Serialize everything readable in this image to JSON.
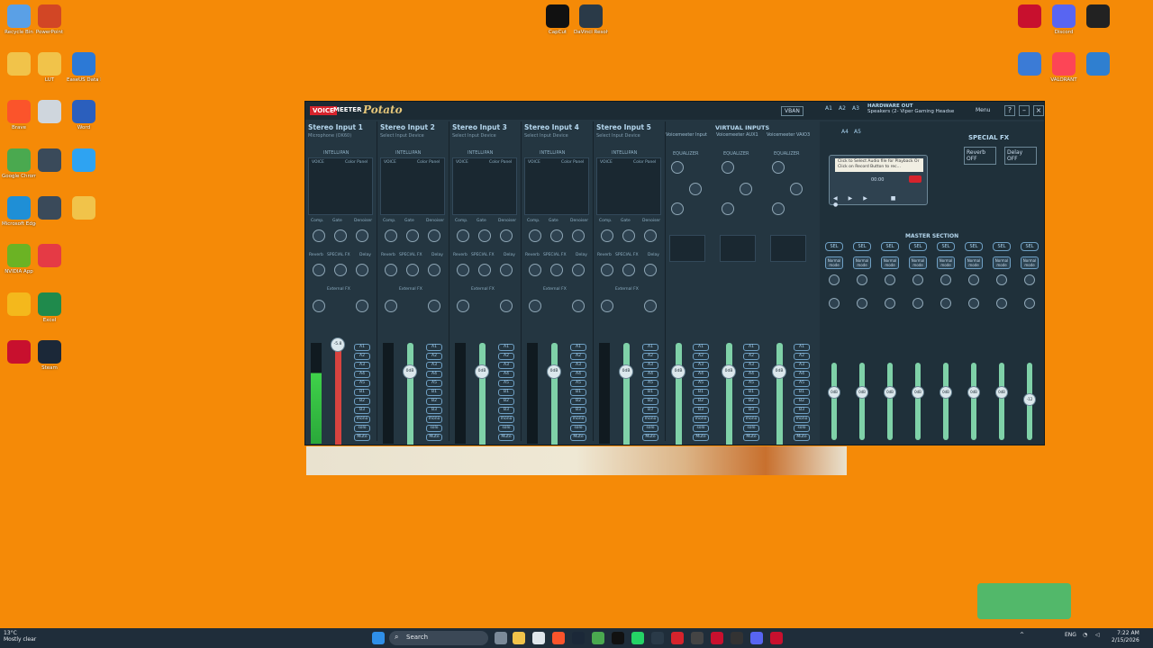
{
  "desktop": {
    "left_icons": [
      {
        "label": "Recycle Bin",
        "icon": "recycle-bin-icon",
        "color": "#5aa0e6"
      },
      {
        "label": "PowerPoint",
        "icon": "powerpoint-icon",
        "color": "#d24625"
      },
      {
        "label": "",
        "icon": "folder-icon",
        "color": "#f1c34a"
      },
      {
        "label": "LUT",
        "icon": "folder-icon",
        "color": "#f1c34a"
      },
      {
        "label": "EaseUS Data Recovery",
        "icon": "easeus-icon",
        "color": "#2c79d6"
      },
      {
        "label": "Brave",
        "icon": "brave-icon",
        "color": "#fb542b"
      },
      {
        "label": "",
        "icon": "document-icon",
        "color": "#cfd6dd"
      },
      {
        "label": "Word",
        "icon": "word-icon",
        "color": "#2b5fbd"
      },
      {
        "label": "Google Chrome",
        "icon": "chrome-icon",
        "color": "#4aa94f"
      },
      {
        "label": "",
        "icon": "player-icon",
        "color": "#3a4a5a"
      },
      {
        "label": "",
        "icon": "app-icon",
        "color": "#2ea3f2"
      },
      {
        "label": "Microsoft Edge",
        "icon": "edge-icon",
        "color": "#1f8fd6"
      },
      {
        "label": "",
        "icon": "player-icon",
        "color": "#3a4a5a"
      },
      {
        "label": "",
        "icon": "folder-icon",
        "color": "#f1c34a"
      },
      {
        "label": "NVIDIA App",
        "icon": "nvidia-icon",
        "color": "#6bb324"
      },
      {
        "label": "",
        "icon": "app-icon",
        "color": "#e53a45"
      },
      {
        "label": "",
        "icon": "app-icon",
        "color": "#f4b81c"
      },
      {
        "label": "Excel",
        "icon": "excel-icon",
        "color": "#1f8a4c"
      },
      {
        "label": "",
        "icon": "app-icon",
        "color": "#c8102e"
      },
      {
        "label": "Steam",
        "icon": "steam-icon",
        "color": "#1b2838"
      }
    ],
    "top_icons": [
      {
        "label": "CapCut",
        "icon": "capcut-icon",
        "color": "#111111"
      },
      {
        "label": "DaVinci Resolve",
        "icon": "davinci-icon",
        "color": "#2a3a48"
      }
    ],
    "right_icons": [
      {
        "label": "",
        "icon": "voicemeeter-icon",
        "color": "#c8102e"
      },
      {
        "label": "Discord",
        "icon": "discord-icon",
        "color": "#5865f2"
      },
      {
        "label": "",
        "icon": "obs-icon",
        "color": "#222222"
      },
      {
        "label": "",
        "icon": "app-icon",
        "color": "#3b7bd6"
      },
      {
        "label": "VALORANT",
        "icon": "valorant-icon",
        "color": "#fd4556"
      },
      {
        "label": "",
        "icon": "app-icon",
        "color": "#2f7fd0"
      }
    ]
  },
  "voicemeeter": {
    "brand_voice": "VOICE",
    "brand_meeter": "MEETER",
    "brand_potato": "Potato",
    "vban": "VBAN",
    "menu": "Menu",
    "hw_buttons": [
      "A1",
      "A2",
      "A3",
      "A4",
      "A5"
    ],
    "hw_out_title": "HARDWARE OUT",
    "hw_out_device": "Speakers (2- Viper Gaming Headse",
    "strips": [
      {
        "name": "Stereo Input 1",
        "sub": "Microphone (OK60)",
        "gain": "-5.8",
        "red": true
      },
      {
        "name": "Stereo Input 2",
        "sub": "Select Input Device",
        "gain": "0dB",
        "red": false
      },
      {
        "name": "Stereo Input 3",
        "sub": "Select Input Device",
        "gain": "0dB",
        "red": false
      },
      {
        "name": "Stereo Input 4",
        "sub": "Select Input Device",
        "gain": "0dB",
        "red": false
      },
      {
        "name": "Stereo Input 5",
        "sub": "Select Input Device",
        "gain": "0dB",
        "red": false
      }
    ],
    "strip_labels": {
      "intellipan": "INTELLIPAN",
      "voice": "VOICE",
      "color_panel": "Color Panel",
      "comp": "Comp.",
      "gate": "Gate",
      "denoiser": "Denoiser",
      "reverb": "Reverb",
      "special_fx": "SPECIAL FX",
      "delay": "Delay",
      "external_fx": "External FX",
      "fader_gain": "Fader Gain"
    },
    "bus_buttons": [
      "A1",
      "A2",
      "A3",
      "A4",
      "A5",
      "B1",
      "B2",
      "B3",
      "mono",
      "solo",
      "Mute"
    ],
    "virtual": {
      "title": "VIRTUAL INPUTS",
      "names": [
        "Voicemeeter Input",
        "Voicemeeter AUX1",
        "Voicemeeter VAIO3"
      ],
      "equalizer": "EQUALIZER",
      "gain": "0dB"
    },
    "special_fx_title": "SPECIAL FX",
    "reverb_box": "Reverb OFF",
    "delay_box": "Delay OFF",
    "cassette_text": "Click to Select Audio file for Playback Or Click on Record Button to rec...",
    "cassette_time": "00:00",
    "master_section": "MASTER SECTION",
    "sel": "SEL",
    "normal_mode": "Normal mode",
    "master_gains": [
      "0dB",
      "0dB",
      "0dB",
      "0dB",
      "0dB",
      "0dB",
      "0dB",
      "-12"
    ]
  },
  "taskbar": {
    "weather_temp": "13°C",
    "weather_desc": "Mostly clear",
    "search": "Search",
    "lang": "ENG",
    "time": "7:22 AM",
    "date": "2/15/2026"
  }
}
